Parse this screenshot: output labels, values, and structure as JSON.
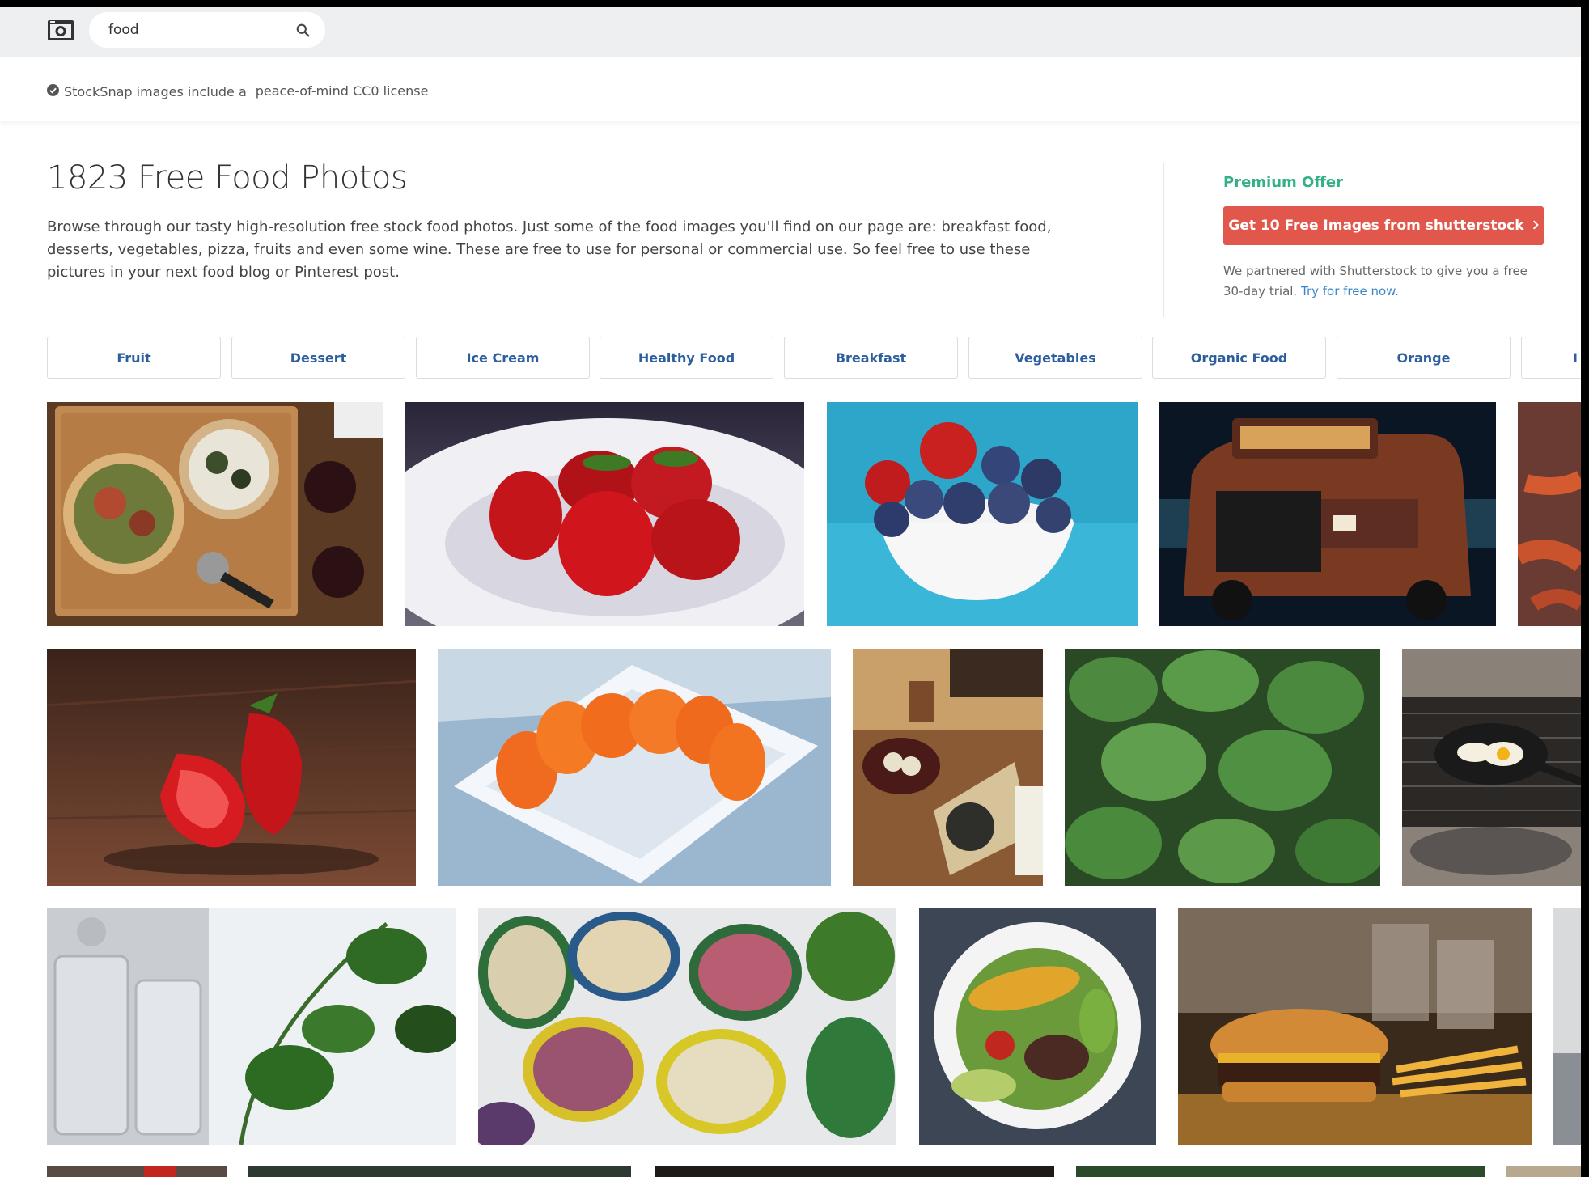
{
  "search": {
    "value": "food",
    "placeholder": ""
  },
  "license": {
    "prefix": "StockSnap images include a",
    "link_text": "peace-of-mind CC0 license"
  },
  "heading": {
    "title": "1823 Free Food Photos",
    "description": "Browse through our tasty high-resolution free stock food photos. Just some of the food images you'll find on our page are: breakfast food, desserts, vegetables, pizza, fruits and even some wine. These are free to use for personal or commercial use. So feel free to use these pictures in your next food blog or Pinterest post."
  },
  "premium": {
    "title": "Premium Offer",
    "button_label": "Get 10 Free Images from shutterstock",
    "text": "We partnered with Shutterstock to give you a free 30-day trial.",
    "link": "Try for free now."
  },
  "tags": [
    "Fruit",
    "Dessert",
    "Ice Cream",
    "Healthy Food",
    "Breakfast",
    "Vegetables",
    "Organic Food",
    "Orange",
    "I"
  ],
  "photos": [
    "pizza",
    "strawberries-plate",
    "berries-bowl",
    "food-truck",
    "carrots",
    "strawberry-halves",
    "orange-segments",
    "asian-meal",
    "mint-leaves",
    "skillet-eggs",
    "glass-jars-herbs",
    "potatoes-baskets",
    "corn-salad-plate",
    "burger-fries",
    "partial-photo",
    "row4-1",
    "row4-2",
    "row4-3",
    "row4-4",
    "row4-5"
  ],
  "colors": {
    "accent": "#e2574c",
    "premium": "#34b089",
    "tag_text": "#2d5f9e",
    "link": "#3a86c8"
  }
}
